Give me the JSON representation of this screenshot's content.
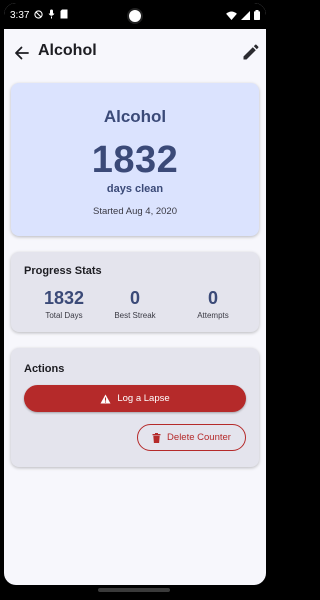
{
  "status_bar": {
    "time": "3:37",
    "icons_left": [
      "do-not-disturb-icon",
      "voice-icon",
      "sd-card-icon"
    ],
    "icons_right": [
      "wifi-icon",
      "signal-icon",
      "battery-icon"
    ]
  },
  "app_bar": {
    "title": "Alcohol",
    "back_icon": "arrow-left-icon",
    "edit_icon": "pencil-icon"
  },
  "hero": {
    "name": "Alcohol",
    "count": "1832",
    "unit": "days clean",
    "started": "Started Aug 4, 2020"
  },
  "stats": {
    "title": "Progress Stats",
    "items": [
      {
        "value": "1832",
        "label": "Total Days"
      },
      {
        "value": "0",
        "label": "Best Streak"
      },
      {
        "value": "0",
        "label": "Attempts"
      }
    ]
  },
  "actions": {
    "title": "Actions",
    "log_lapse_label": "Log a Lapse",
    "delete_label": "Delete Counter"
  },
  "colors": {
    "accent": "#3b4a78",
    "hero_bg": "#dbe3fe",
    "danger": "#b52a2a",
    "card_bg": "#e4e4ed",
    "screen_bg": "#f7f7fc"
  }
}
